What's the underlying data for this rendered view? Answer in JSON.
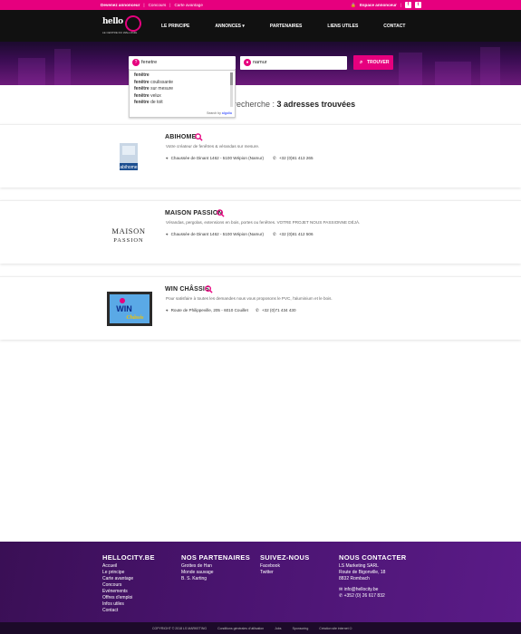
{
  "topbar": {
    "links": [
      "Devenez annonceur",
      "Concours",
      "Carte avantage"
    ],
    "espace": "Espace annonceur",
    "social": [
      "f",
      "t"
    ]
  },
  "nav": {
    "logo_text": "hello",
    "logo_sub": "LE CENTRE DU WALLONIE",
    "menu": [
      "LE PRINCIPE",
      "ANNONCES ▾",
      "PARTENAIRES",
      "LIENS UTILES",
      "CONTACT"
    ]
  },
  "search": {
    "what_value": "fenetre",
    "where_value": "namur",
    "button_label": "TROUVER",
    "suggestions": [
      {
        "bold": "fenêtre",
        "rest": ""
      },
      {
        "bold": "fenêtre",
        "rest": " coulissante"
      },
      {
        "bold": "fenêtre",
        "rest": " sur mesure"
      },
      {
        "bold": "fenêtre",
        "rest": " velux"
      },
      {
        "bold": "fenêtre",
        "rest": " de toit"
      }
    ],
    "powered_by": "Search by",
    "powered_brand": "algolia"
  },
  "results": {
    "prefix": "recherche : ",
    "count_text": "3 adresses trouvées"
  },
  "listings": [
    {
      "name": "ABIHOME",
      "desc": "Votre créateur de fenêtres & vérandas sur mesure.",
      "address": "Chaussée de Dinant 1462 - 5100 Wépion (Namur)",
      "phone": "+32 (0)81 413 265",
      "logo_text": "abihome"
    },
    {
      "name": "MAISON PASSION",
      "desc": "Vérandas, pergolas, extensions en bois, portes ou fenêtres. VOTRE PROJET NOUS PASSIONNE DÉJÀ.",
      "address": "Chaussée de Dinant 1462 - 5100 Wépion (Namur)",
      "phone": "+32 (0)81 412 506",
      "logo_text_1": "MAISON",
      "logo_text_2": "PASSION"
    },
    {
      "name": "WIN CHÂSSIS",
      "desc": "Pour satisfaire à toutes les demandes nous vous proposons le PVC, l'aluminium et le bois.",
      "address": "Route de Philippeville, 205 - 6010 Couillet",
      "phone": "+32 (0)71 434 430",
      "logo_text_1": "WIN",
      "logo_text_2": "Châssis"
    }
  ],
  "footer": {
    "col1": {
      "title": "HELLOCITY.BE",
      "links": [
        "Accueil",
        "Le principe",
        "Carte avantage",
        "Concours",
        "Evénements",
        "Offres d'emploi",
        "Infos utiles",
        "Contact"
      ]
    },
    "col2": {
      "title": "NOS PARTENAIRES",
      "links": [
        "Grottes de Han",
        "Monde sauvage",
        "B. S. Karting"
      ]
    },
    "col3": {
      "title": "SUIVEZ-NOUS",
      "links": [
        "Facebook",
        "Twitter"
      ]
    },
    "col4": {
      "title": "NOUS CONTACTER",
      "lines": [
        "LS Marketing SARL",
        "Route de Bigonville, 18",
        "8832 Rombach"
      ],
      "email": "info@hellocity.be",
      "phone": "+352 (0) 26 617 832"
    },
    "bottom": [
      "COPYRIGHT © 2018 LS MARKETING",
      "Conditions générales d'utilisation",
      "Jobs",
      "Sponsoring",
      "Création site internet"
    ]
  },
  "colors": {
    "accent": "#e6007e",
    "footer_bg": "#4a1470",
    "nav_bg": "#111111"
  }
}
